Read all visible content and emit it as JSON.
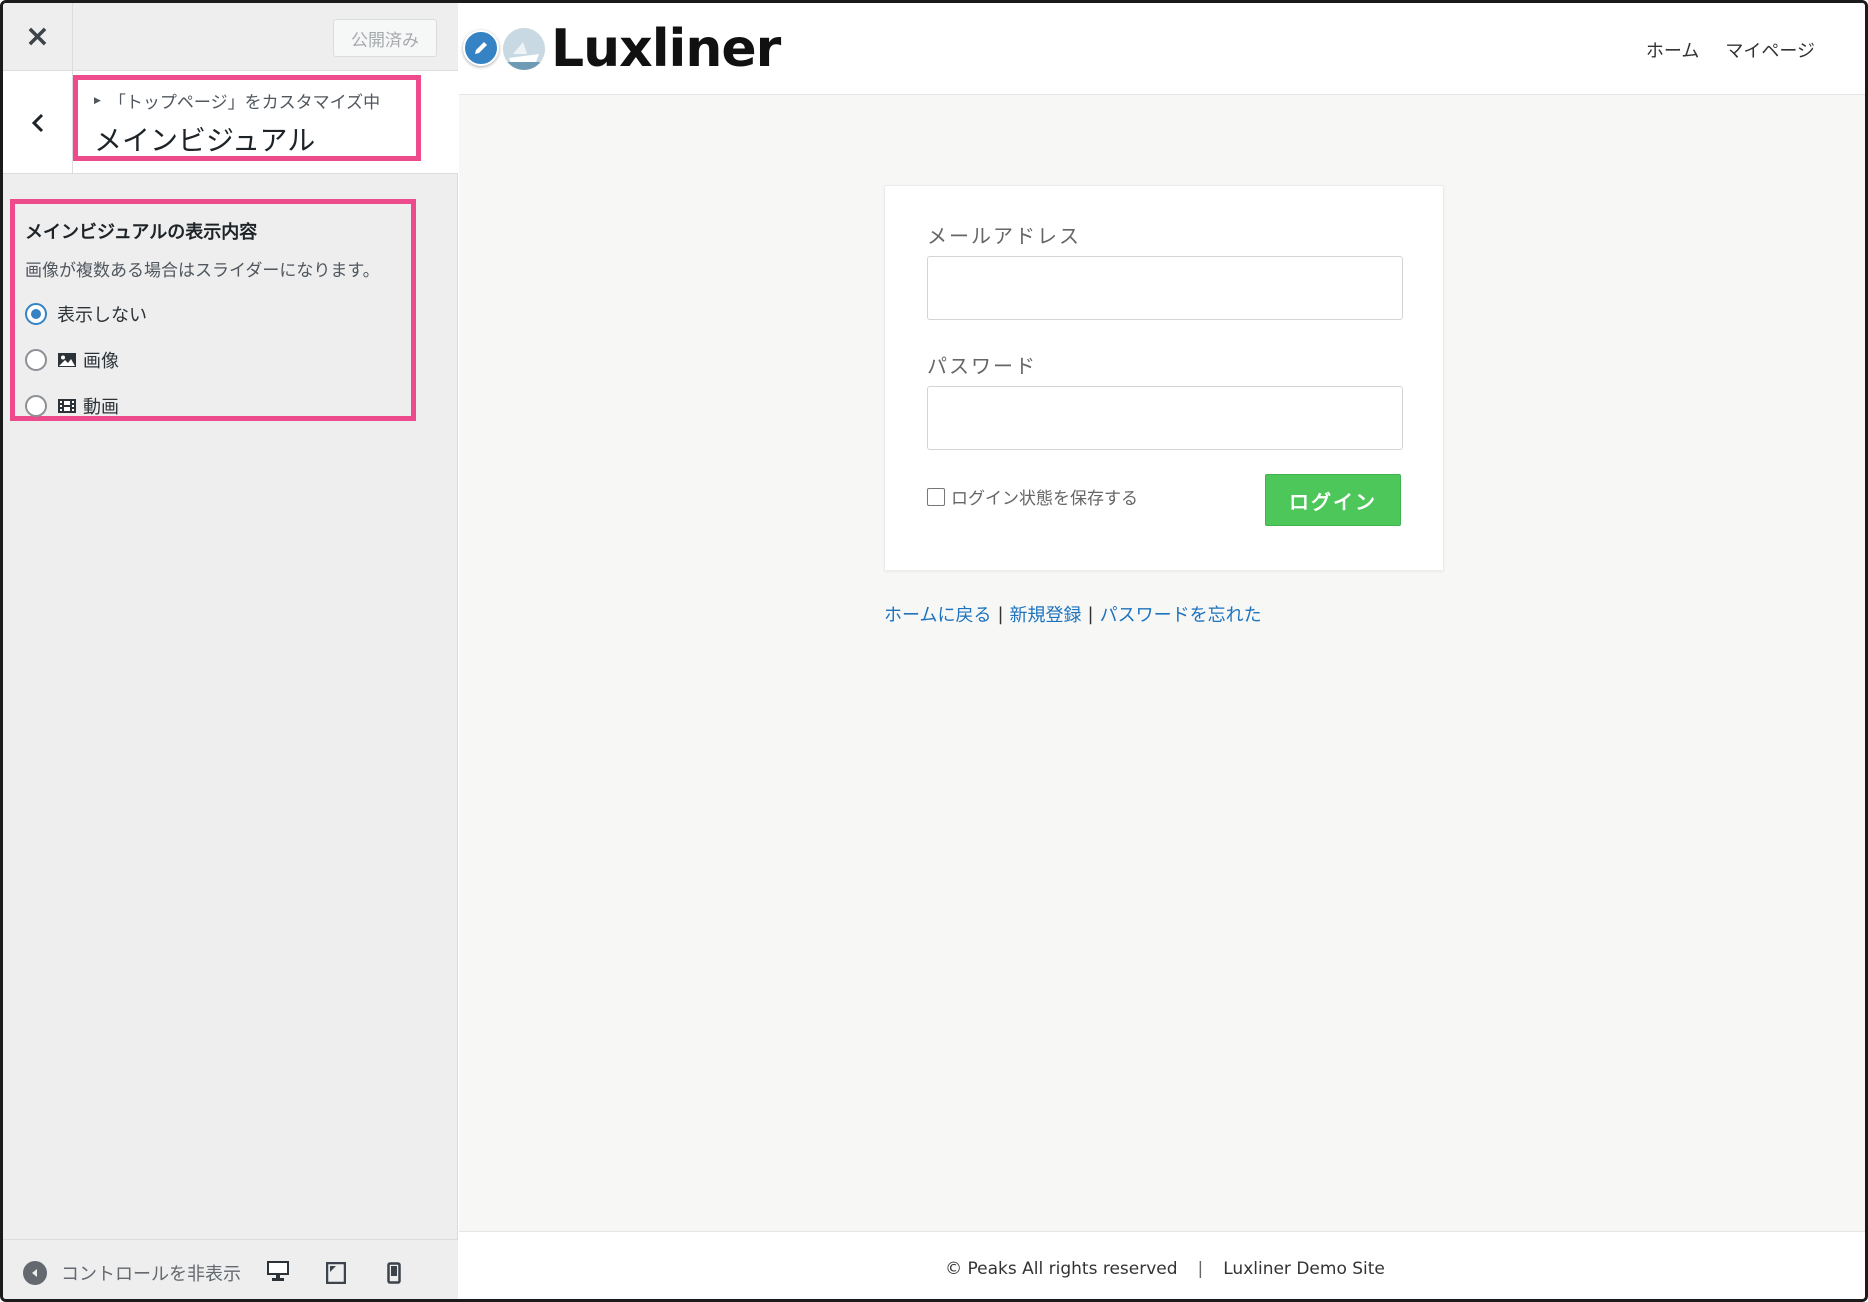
{
  "customizer": {
    "close_label": "×",
    "publish_label": "公開済み",
    "breadcrumb": "「トップページ」をカスタマイズ中",
    "section_title": "メインビジュアル",
    "control": {
      "title": "メインビジュアルの表示内容",
      "description": "画像が複数ある場合はスライダーになります。",
      "options": [
        {
          "label": "表示しない",
          "icon": "none",
          "checked": true
        },
        {
          "label": "画像",
          "icon": "image-icon",
          "checked": false
        },
        {
          "label": "動画",
          "icon": "video-icon",
          "checked": false
        }
      ]
    },
    "footer": {
      "collapse_label": "コントロールを非表示",
      "devices": [
        "desktop-icon",
        "tablet-icon",
        "mobile-icon"
      ],
      "active_device": "desktop"
    },
    "highlight_color": "#ee4b8c"
  },
  "site": {
    "logo_text": "Luxliner",
    "nav": [
      "ホーム",
      "マイページ"
    ],
    "login": {
      "email_label": "メールアドレス",
      "password_label": "パスワード",
      "email_value": "",
      "password_value": "",
      "remember_label": "ログイン状態を保存する",
      "remember_checked": false,
      "submit_label": "ログイン",
      "submit_color": "#4dc75a"
    },
    "links": [
      "ホームに戻る",
      "新規登録",
      "パスワードを忘れた"
    ],
    "link_separator": "|",
    "footer": {
      "copyright": "© Peaks All rights reserved",
      "separator": "|",
      "site_name": "Luxliner Demo Site"
    }
  }
}
